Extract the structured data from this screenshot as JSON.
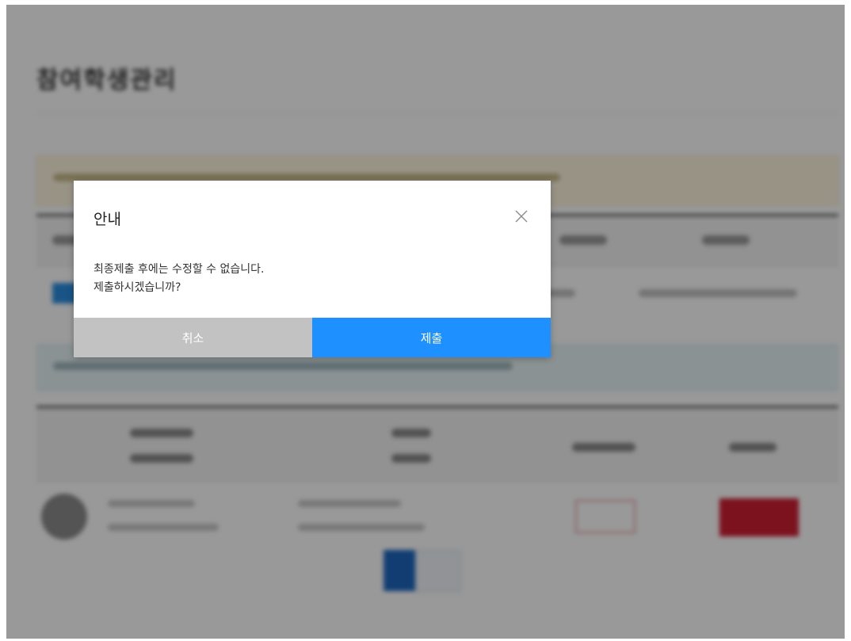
{
  "background": {
    "page_title": "참여학생관리"
  },
  "dialog": {
    "title": "안내",
    "message_line1": "최종제출 후에는 수정할 수 없습니다.",
    "message_line2": "제출하시겠습니까?",
    "cancel_label": "취소",
    "submit_label": "제출",
    "close_icon": "close-icon"
  },
  "colors": {
    "submit_button": "#1e90ff",
    "cancel_button": "#c2c2c2",
    "overlay": "rgba(0,0,0,0.40)",
    "delete_button": "#d01f34"
  }
}
